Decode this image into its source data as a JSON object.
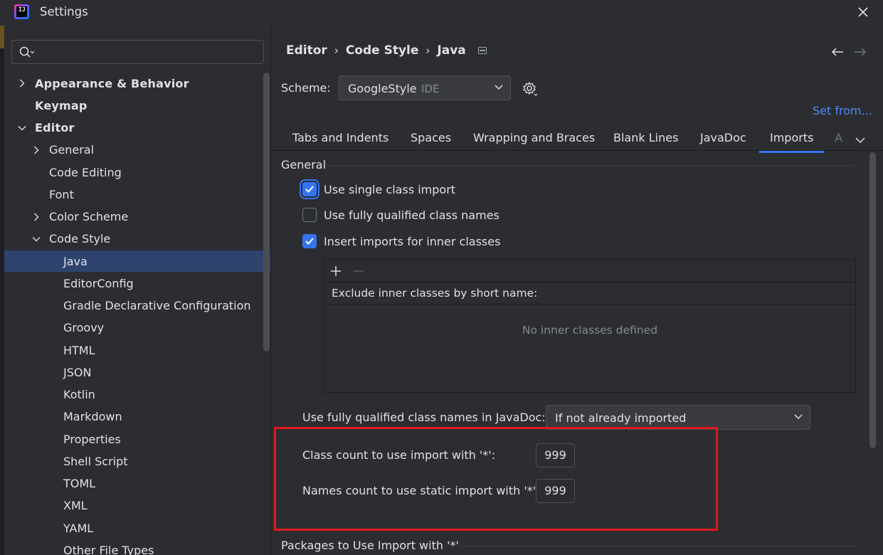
{
  "window": {
    "title": "Settings"
  },
  "sidebar": {
    "search_placeholder": "",
    "items": [
      {
        "label": "Appearance & Behavior",
        "level": 0,
        "expandable": true,
        "expanded": false,
        "bold": true
      },
      {
        "label": "Keymap",
        "level": 0,
        "expandable": false,
        "bold": true
      },
      {
        "label": "Editor",
        "level": 0,
        "expandable": true,
        "expanded": true,
        "bold": true
      },
      {
        "label": "General",
        "level": 1,
        "expandable": true,
        "expanded": false
      },
      {
        "label": "Code Editing",
        "level": 1,
        "expandable": false
      },
      {
        "label": "Font",
        "level": 1,
        "expandable": false
      },
      {
        "label": "Color Scheme",
        "level": 1,
        "expandable": true,
        "expanded": false
      },
      {
        "label": "Code Style",
        "level": 1,
        "expandable": true,
        "expanded": true
      },
      {
        "label": "Java",
        "level": 2,
        "selected": true
      },
      {
        "label": "EditorConfig",
        "level": 2
      },
      {
        "label": "Gradle Declarative Configuration",
        "level": 2
      },
      {
        "label": "Groovy",
        "level": 2
      },
      {
        "label": "HTML",
        "level": 2
      },
      {
        "label": "JSON",
        "level": 2
      },
      {
        "label": "Kotlin",
        "level": 2
      },
      {
        "label": "Markdown",
        "level": 2
      },
      {
        "label": "Properties",
        "level": 2
      },
      {
        "label": "Shell Script",
        "level": 2
      },
      {
        "label": "TOML",
        "level": 2
      },
      {
        "label": "XML",
        "level": 2
      },
      {
        "label": "YAML",
        "level": 2
      },
      {
        "label": "Other File Types",
        "level": 2
      }
    ]
  },
  "breadcrumb": [
    "Editor",
    "Code Style",
    "Java"
  ],
  "breadcrumb_separator": "›",
  "scheme": {
    "label": "Scheme:",
    "value": "GoogleStyle",
    "badge": "IDE",
    "set_from": "Set from..."
  },
  "tabs": [
    {
      "label": "Tabs and Indents"
    },
    {
      "label": "Spaces"
    },
    {
      "label": "Wrapping and Braces"
    },
    {
      "label": "Blank Lines"
    },
    {
      "label": "JavaDoc"
    },
    {
      "label": "Imports",
      "active": true
    },
    {
      "label": "A",
      "faded": true
    }
  ],
  "general": {
    "title": "General",
    "checkboxes": [
      {
        "label": "Use single class import",
        "checked": true,
        "focused": true
      },
      {
        "label": "Use fully qualified class names",
        "checked": false
      },
      {
        "label": "Insert imports for inner classes",
        "checked": true
      }
    ],
    "exclude": {
      "header": "Exclude inner classes by short name:",
      "empty_text": "No inner classes defined"
    },
    "javadoc": {
      "label": "Use fully qualified class names in JavaDoc:",
      "value": "If not already imported"
    },
    "class_count": {
      "label": "Class count to use import with '*':",
      "value": "999"
    },
    "names_count": {
      "label": "Names count to use static import with '*':",
      "value": "999"
    }
  },
  "packages": {
    "title": "Packages to Use Import with '*'"
  },
  "colors": {
    "accent": "#3574f0",
    "link": "#548af7",
    "selection": "#2e436e",
    "highlight_box": "#e2161e",
    "background": "#2b2d30"
  }
}
